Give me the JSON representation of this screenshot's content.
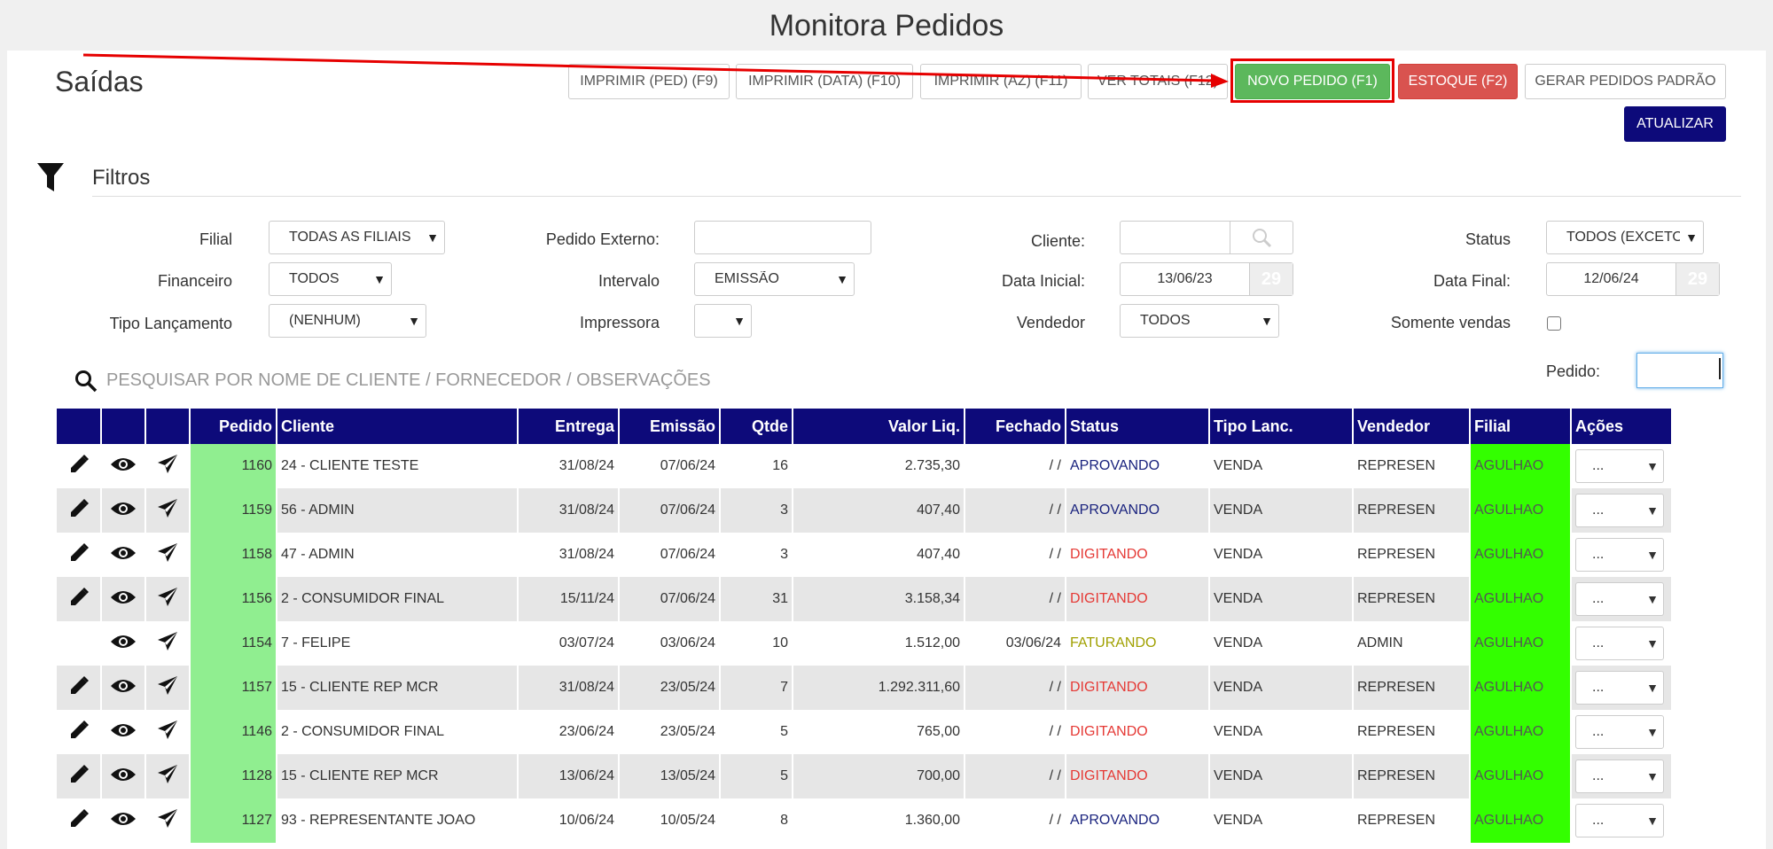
{
  "page_title": "Monitora Pedidos",
  "section_title": "Saídas",
  "toolbar": {
    "print_ped": "IMPRIMIR (PED) (F9)",
    "print_data": "IMPRIMIR (DATA) (F10)",
    "print_az": "IMPRIMIR (AZ) (F11)",
    "ver_totais": "VER TOTAIS (F12)",
    "novo_pedido": "NOVO PEDIDO (F1)",
    "estoque": "ESTOQUE (F2)",
    "gerar_padrao": "GERAR PEDIDOS PADRÃO",
    "atualizar": "ATUALIZAR"
  },
  "filters": {
    "title": "Filtros",
    "filial_label": "Filial",
    "filial_value": "TODAS AS FILIAIS",
    "pedido_externo_label": "Pedido Externo:",
    "pedido_externo_value": "",
    "cliente_label": "Cliente:",
    "cliente_value": "",
    "status_label": "Status",
    "status_value": "TODOS (EXCETO",
    "financeiro_label": "Financeiro",
    "financeiro_value": "TODOS",
    "intervalo_label": "Intervalo",
    "intervalo_value": "EMISSÃO",
    "data_inicial_label": "Data Inicial:",
    "data_inicial_value": "13/06/23",
    "data_final_label": "Data Final:",
    "data_final_value": "12/06/24",
    "calendar_day": "29",
    "tipo_lanc_label": "Tipo Lançamento",
    "tipo_lanc_value": "(NENHUM)",
    "impressora_label": "Impressora",
    "impressora_value": "",
    "vendedor_label": "Vendedor",
    "vendedor_value": "TODOS",
    "somente_vendas_label": "Somente vendas"
  },
  "search": {
    "placeholder": "PESQUISAR POR NOME DE CLIENTE / FORNECEDOR / OBSERVAÇÕES"
  },
  "pedido_filter": {
    "label": "Pedido:",
    "value": ""
  },
  "table": {
    "columns": [
      "",
      "",
      "",
      "Pedido",
      "Cliente",
      "Entrega",
      "Emissão",
      "Qtde",
      "Valor Liq.",
      "Fechado",
      "Status",
      "Tipo Lanc.",
      "Vendedor",
      "Filial",
      "Ações"
    ],
    "action_value": "...",
    "rows": [
      {
        "pedido": "1160",
        "cliente": "24 - CLIENTE TESTE",
        "entrega": "31/08/24",
        "emissao": "07/06/24",
        "qtde": "16",
        "valor": "2.735,30",
        "fechado": "/ /",
        "status": "APROVANDO",
        "tipo": "VENDA",
        "vendedor": "REPRESEN",
        "filial": "AGULHAO",
        "editable": true
      },
      {
        "pedido": "1159",
        "cliente": "56 - ADMIN",
        "entrega": "31/08/24",
        "emissao": "07/06/24",
        "qtde": "3",
        "valor": "407,40",
        "fechado": "/ /",
        "status": "APROVANDO",
        "tipo": "VENDA",
        "vendedor": "REPRESEN",
        "filial": "AGULHAO",
        "editable": true
      },
      {
        "pedido": "1158",
        "cliente": "47 - ADMIN",
        "entrega": "31/08/24",
        "emissao": "07/06/24",
        "qtde": "3",
        "valor": "407,40",
        "fechado": "/ /",
        "status": "DIGITANDO",
        "tipo": "VENDA",
        "vendedor": "REPRESEN",
        "filial": "AGULHAO",
        "editable": true
      },
      {
        "pedido": "1156",
        "cliente": "2 - CONSUMIDOR FINAL",
        "entrega": "15/11/24",
        "emissao": "07/06/24",
        "qtde": "31",
        "valor": "3.158,34",
        "fechado": "/ /",
        "status": "DIGITANDO",
        "tipo": "VENDA",
        "vendedor": "REPRESEN",
        "filial": "AGULHAO",
        "editable": true
      },
      {
        "pedido": "1154",
        "cliente": "7 - FELIPE",
        "entrega": "03/07/24",
        "emissao": "03/06/24",
        "qtde": "10",
        "valor": "1.512,00",
        "fechado": "03/06/24",
        "status": "FATURANDO",
        "tipo": "VENDA",
        "vendedor": "ADMIN",
        "filial": "AGULHAO",
        "editable": false
      },
      {
        "pedido": "1157",
        "cliente": "15 - CLIENTE REP MCR",
        "entrega": "31/08/24",
        "emissao": "23/05/24",
        "qtde": "7",
        "valor": "1.292.311,60",
        "fechado": "/ /",
        "status": "DIGITANDO",
        "tipo": "VENDA",
        "vendedor": "REPRESEN",
        "filial": "AGULHAO",
        "editable": true
      },
      {
        "pedido": "1146",
        "cliente": "2 - CONSUMIDOR FINAL",
        "entrega": "23/06/24",
        "emissao": "23/05/24",
        "qtde": "5",
        "valor": "765,00",
        "fechado": "/ /",
        "status": "DIGITANDO",
        "tipo": "VENDA",
        "vendedor": "REPRESEN",
        "filial": "AGULHAO",
        "editable": true
      },
      {
        "pedido": "1128",
        "cliente": "15 - CLIENTE REP MCR",
        "entrega": "13/06/24",
        "emissao": "13/05/24",
        "qtde": "5",
        "valor": "700,00",
        "fechado": "/ /",
        "status": "DIGITANDO",
        "tipo": "VENDA",
        "vendedor": "REPRESEN",
        "filial": "AGULHAO",
        "editable": true
      },
      {
        "pedido": "1127",
        "cliente": "93 - REPRESENTANTE JOAO",
        "entrega": "10/06/24",
        "emissao": "10/05/24",
        "qtde": "8",
        "valor": "1.360,00",
        "fechado": "/ /",
        "status": "APROVANDO",
        "tipo": "VENDA",
        "vendedor": "REPRESEN",
        "filial": "AGULHAO",
        "editable": true
      }
    ]
  },
  "colors": {
    "header_navy": "#0d0a7a",
    "pedido_green": "#90ee90",
    "filial_green": "#33ff00",
    "annotation_red": "#e60000"
  }
}
